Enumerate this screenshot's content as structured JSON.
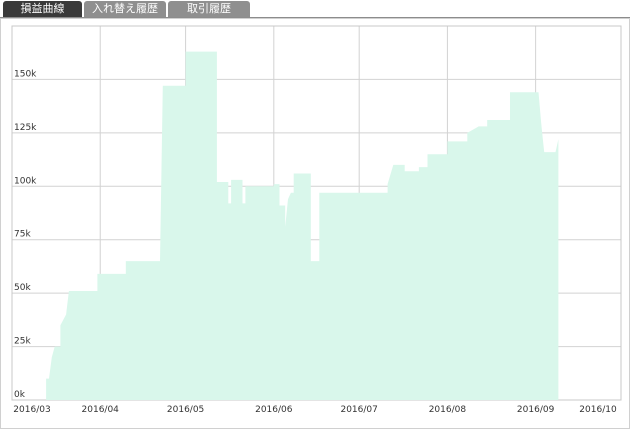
{
  "tabs": [
    {
      "label": "損益曲線",
      "active": true
    },
    {
      "label": "入れ替え履歴",
      "active": false
    },
    {
      "label": "取引履歴",
      "active": false
    }
  ],
  "colors": {
    "area_fill": "#d9f7eb",
    "grid": "#d2d2d2",
    "tab_active": "#3a3a3a",
    "tab_inactive": "#8f8f8f"
  },
  "chart_data": {
    "type": "area",
    "title": "",
    "xlabel": "",
    "ylabel": "",
    "x_tick_labels": [
      "2016/03",
      "2016/04",
      "2016/05",
      "2016/06",
      "2016/07",
      "2016/08",
      "2016/09",
      "2016/10"
    ],
    "y_tick_labels": [
      "0k",
      "25k",
      "50k",
      "75k",
      "100k",
      "125k",
      "150k"
    ],
    "ylim": [
      0,
      175000
    ],
    "xlim": [
      "2016-03-01",
      "2016-10-01"
    ],
    "grid": true,
    "legend": "none",
    "series": [
      {
        "points": [
          [
            "2016-03-13",
            0
          ],
          [
            "2016-03-13",
            10000
          ],
          [
            "2016-03-14",
            10000
          ],
          [
            "2016-03-15",
            20000
          ],
          [
            "2016-03-16",
            25000
          ],
          [
            "2016-03-18",
            25000
          ],
          [
            "2016-03-18",
            35000
          ],
          [
            "2016-03-20",
            40000
          ],
          [
            "2016-03-21",
            51000
          ],
          [
            "2016-03-31",
            51000
          ],
          [
            "2016-03-31",
            59000
          ],
          [
            "2016-04-10",
            59000
          ],
          [
            "2016-04-10",
            65000
          ],
          [
            "2016-04-22",
            65000
          ],
          [
            "2016-04-23",
            147000
          ],
          [
            "2016-05-01",
            147000
          ],
          [
            "2016-05-01",
            163000
          ],
          [
            "2016-05-12",
            163000
          ],
          [
            "2016-05-12",
            102000
          ],
          [
            "2016-05-16",
            102000
          ],
          [
            "2016-05-16",
            92000
          ],
          [
            "2016-05-17",
            92000
          ],
          [
            "2016-05-17",
            103000
          ],
          [
            "2016-05-21",
            103000
          ],
          [
            "2016-05-21",
            92000
          ],
          [
            "2016-05-22",
            92000
          ],
          [
            "2016-05-22",
            100000
          ],
          [
            "2016-06-01",
            100000
          ],
          [
            "2016-06-01",
            101000
          ],
          [
            "2016-06-03",
            101000
          ],
          [
            "2016-06-03",
            91000
          ],
          [
            "2016-06-05",
            91000
          ],
          [
            "2016-06-05",
            81000
          ],
          [
            "2016-06-06",
            94000
          ],
          [
            "2016-06-07",
            97000
          ],
          [
            "2016-06-08",
            97000
          ],
          [
            "2016-06-08",
            106000
          ],
          [
            "2016-06-14",
            106000
          ],
          [
            "2016-06-14",
            65000
          ],
          [
            "2016-06-17",
            65000
          ],
          [
            "2016-06-17",
            97000
          ],
          [
            "2016-07-11",
            97000
          ],
          [
            "2016-07-11",
            101000
          ],
          [
            "2016-07-13",
            110000
          ],
          [
            "2016-07-17",
            110000
          ],
          [
            "2016-07-17",
            107000
          ],
          [
            "2016-07-22",
            107000
          ],
          [
            "2016-07-22",
            109000
          ],
          [
            "2016-07-25",
            109000
          ],
          [
            "2016-07-25",
            115000
          ],
          [
            "2016-08-01",
            115000
          ],
          [
            "2016-08-01",
            121000
          ],
          [
            "2016-08-08",
            121000
          ],
          [
            "2016-08-08",
            125000
          ],
          [
            "2016-08-12",
            128000
          ],
          [
            "2016-08-15",
            128000
          ],
          [
            "2016-08-15",
            131000
          ],
          [
            "2016-08-23",
            131000
          ],
          [
            "2016-08-23",
            144000
          ],
          [
            "2016-09-02",
            144000
          ],
          [
            "2016-09-03",
            129000
          ],
          [
            "2016-09-04",
            116000
          ],
          [
            "2016-09-08",
            116000
          ],
          [
            "2016-09-09",
            122000
          ],
          [
            "2016-09-09",
            0
          ]
        ]
      }
    ]
  }
}
